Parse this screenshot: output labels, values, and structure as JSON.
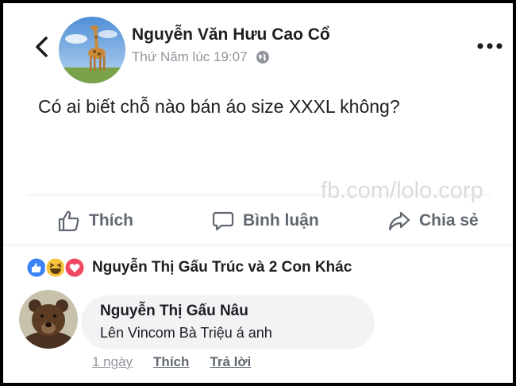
{
  "post": {
    "author": "Nguyễn Văn Hưu Cao Cổ",
    "timestamp": "Thứ Năm lúc 19:07",
    "privacy_icon": "globe-icon",
    "text": "Có ai biết chỗ nào bán áo size XXXL không?",
    "watermark": "fb.com/lolo.corp"
  },
  "actions": {
    "like_label": "Thích",
    "comment_label": "Bình luận",
    "share_label": "Chia sẻ"
  },
  "reactions": {
    "icons": [
      "like-reaction-icon",
      "haha-reaction-icon",
      "love-reaction-icon"
    ],
    "summary": "Nguyễn Thị Gấu Trúc và 2 Con Khác"
  },
  "comment": {
    "author": "Nguyễn Thị Gấu Nâu",
    "text": "Lên Vincom Bà Triệu á anh",
    "time": "1 ngày",
    "like_label": "Thích",
    "reply_label": "Trả lời"
  },
  "colors": {
    "like_blue": "#3b82f6",
    "love_red": "#f04862",
    "haha_yellow": "#f7c33b",
    "secondary_text": "#90949c",
    "bubble_bg": "#f2f3f5"
  }
}
